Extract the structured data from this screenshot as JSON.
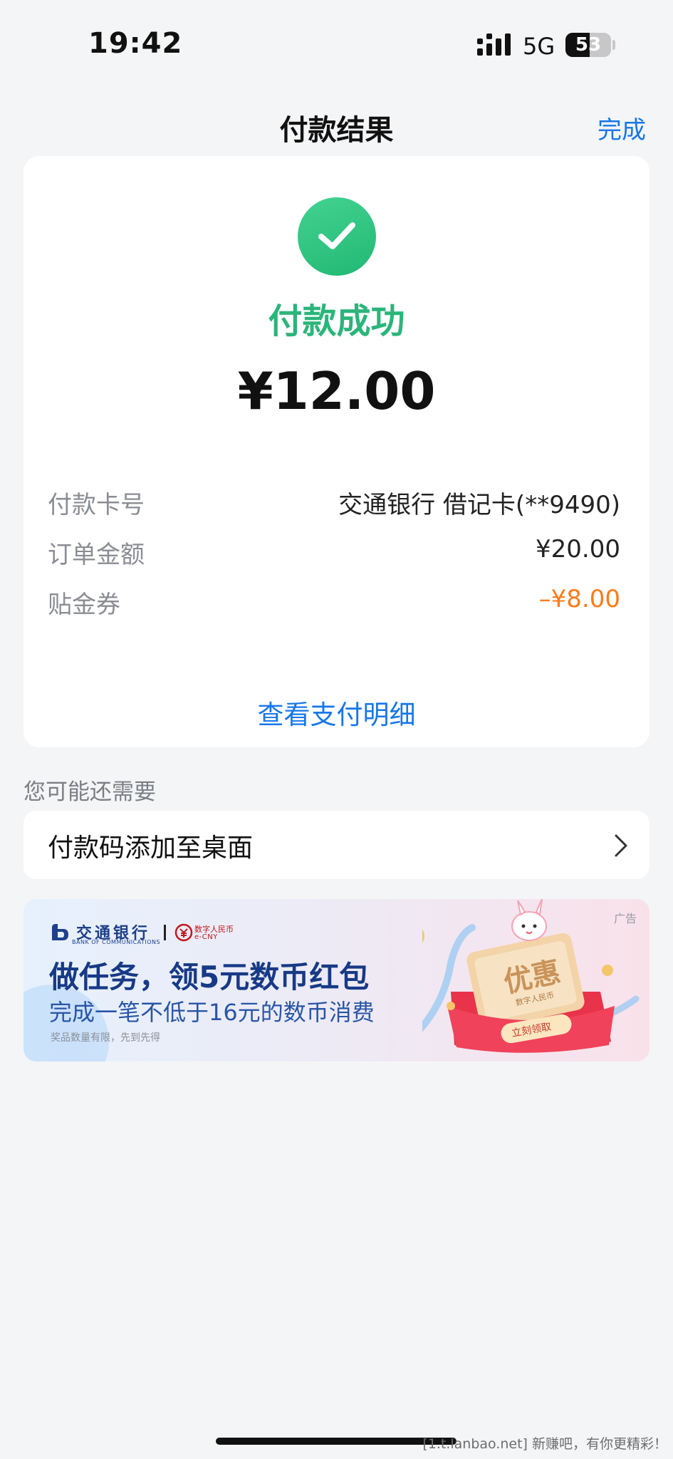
{
  "status_bar": {
    "time": "19:42",
    "network": "5G",
    "battery_level": 53,
    "battery_text": "53",
    "signal_icon": "signal-bars-icon"
  },
  "nav": {
    "title": "付款结果",
    "done_label": "完成"
  },
  "result": {
    "icon": "check-circle-icon",
    "status_text": "付款成功",
    "amount": "¥12.00",
    "details": [
      {
        "label": "付款卡号",
        "value": "交通银行 借记卡(**9490)"
      },
      {
        "label": "订单金额",
        "value": "¥20.00"
      },
      {
        "label": "贴金券",
        "value": "–¥8.00"
      }
    ],
    "view_details_label": "查看支付明细"
  },
  "suggestions": {
    "heading": "您可能还需要",
    "add_shortcut_label": "付款码添加至桌面",
    "chevron_icon": "chevron-right-icon"
  },
  "ad": {
    "tag": "广告",
    "bank_name_cn": "交通银行",
    "bank_name_en": "BANK OF COMMUNICATIONS",
    "ecny_name_cn": "数字人民币",
    "ecny_name_en": "e-CNY",
    "headline": "做任务，领5元数币红包",
    "subline": "完成一笔不低于16元的数币消费",
    "footnote": "奖品数量有限，先到先得",
    "coupon_text": "优惠",
    "coupon_sub": "数字人民币",
    "button_text": "立刻领取"
  },
  "watermark": "[1.t.lanbao.net] 新赚吧，有你更精彩！",
  "colors": {
    "accent_blue": "#1677e8",
    "success_green": "#2bb57a",
    "discount_orange": "#ff7a18",
    "page_bg": "#f4f5f7"
  }
}
